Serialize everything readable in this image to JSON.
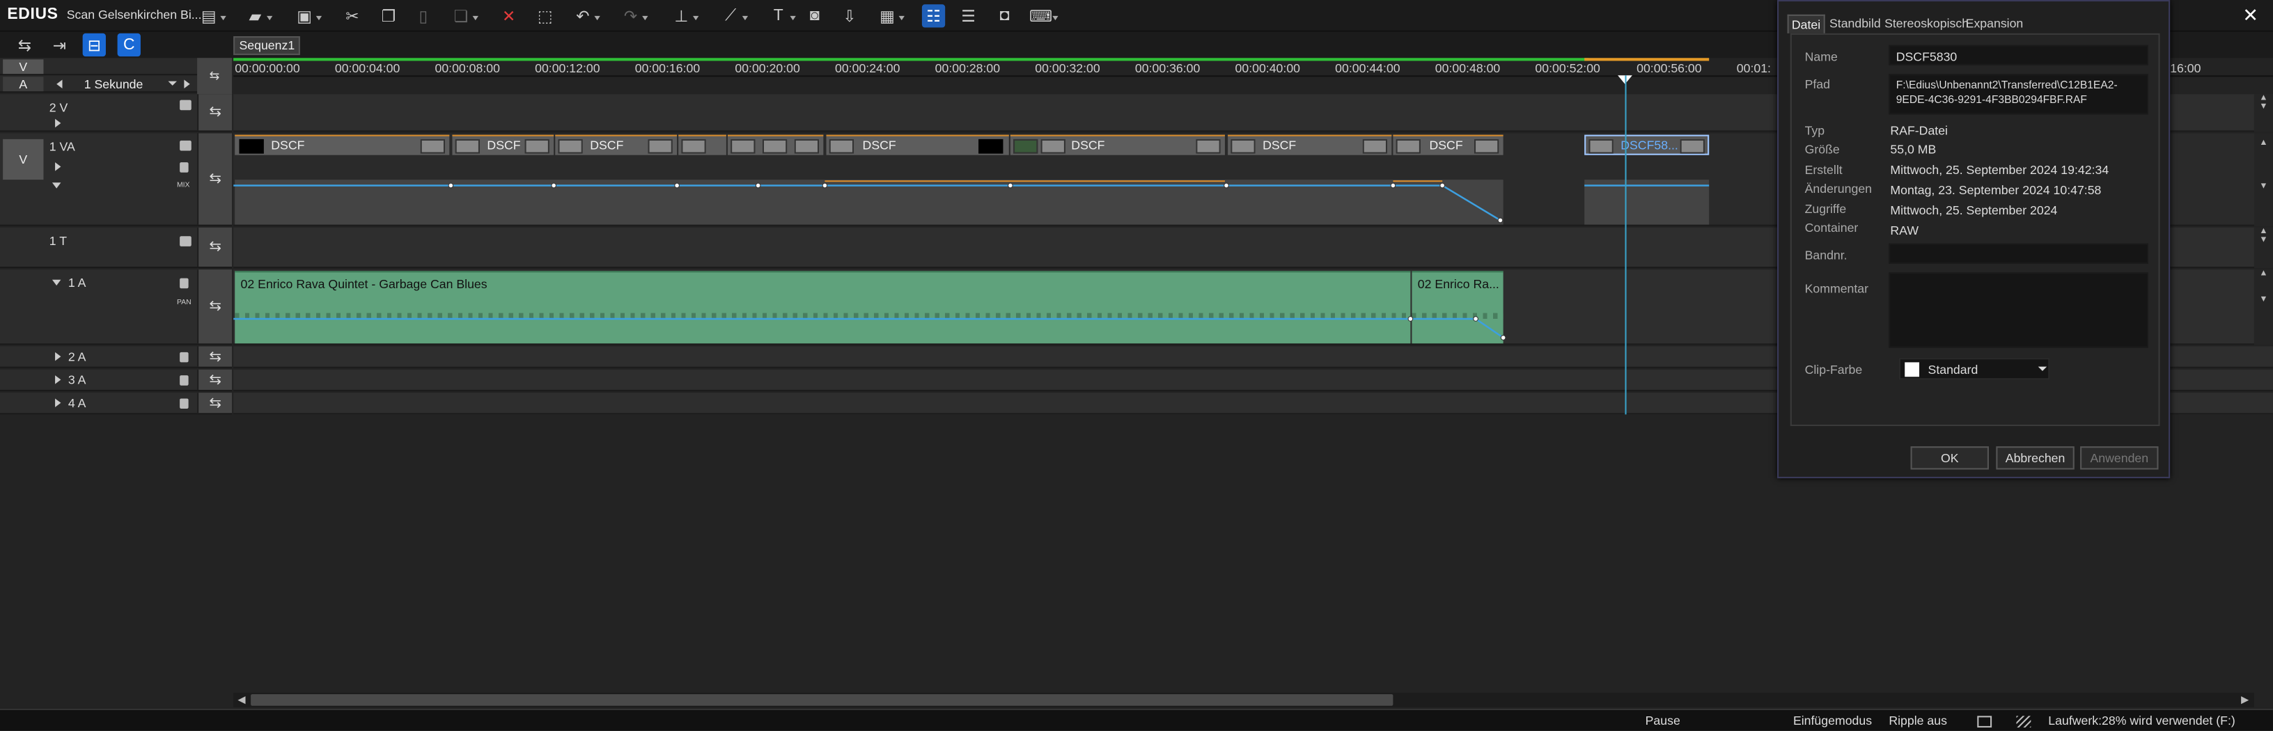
{
  "app": {
    "name": "EDIUS",
    "project": "Scan Gelsenkirchen Bi..."
  },
  "timeline": {
    "sequence_tab": "Sequenz1",
    "scale": "1 Sekunde",
    "track_mode_v": "V",
    "track_mode_a": "A",
    "ruler_ticks": [
      "00:00:00:00",
      "00:00:04:00",
      "00:00:08:00",
      "00:00:12:00",
      "00:00:16:00",
      "00:00:20:00",
      "00:00:24:00",
      "00:00:28:00",
      "00:00:32:00",
      "00:00:36:00",
      "00:00:40:00",
      "00:00:44:00",
      "00:00:48:00",
      "00:00:52:00",
      "00:00:56:00",
      "00:01:",
      "16:00"
    ],
    "tracks": {
      "t2v": "2 V",
      "t1va": "1 VA",
      "t1t": "1 T",
      "t1a": "1 A",
      "t2a": "2 A",
      "t3a": "3 A",
      "t4a": "4 A",
      "va_badge": "V"
    },
    "video_clip_labels": [
      "DSCF",
      "DSCF",
      "DSCF",
      "DSCF",
      "DSCF",
      "DSCF",
      "DSCF",
      "DSCF58..."
    ],
    "audio_clips": [
      "02 Enrico Rava Quintet - Garbage Can Blues",
      "02 Enrico Ra..."
    ],
    "mix_label": "MIX",
    "pan_label": "PAN"
  },
  "dialog": {
    "tabs": [
      "Datei",
      "Standbild",
      "Stereoskopisch",
      "Expansion"
    ],
    "fields": {
      "name_label": "Name",
      "name_value": "DSCF5830",
      "path_label": "Pfad",
      "path_value": "F:\\Edius\\Unbenannt2\\Transferred\\C12B1EA2-9EDE-4C36-9291-4F3BB0294FBF.RAF",
      "type_label": "Typ",
      "type_value": "RAF-Datei",
      "size_label": "Größe",
      "size_value": "55,0 MB",
      "created_label": "Erstellt",
      "created_value": "Mittwoch, 25. September 2024 19:42:34",
      "modified_label": "Änderungen",
      "modified_value": "Montag, 23. September 2024 10:47:58",
      "accessed_label": "Zugriffe",
      "accessed_value": "Mittwoch, 25. September 2024",
      "container_label": "Container",
      "container_value": "RAW",
      "tape_label": "Bandnr.",
      "tape_value": "",
      "comment_label": "Kommentar",
      "comment_value": "",
      "color_label": "Clip-Farbe",
      "color_value": "Standard"
    },
    "buttons": {
      "ok": "OK",
      "cancel": "Abbrechen",
      "apply": "Anwenden"
    }
  },
  "status": {
    "pause": "Pause",
    "insert_mode": "Einfügemodus",
    "ripple": "Ripple aus",
    "drive": "Laufwerk:28% wird verwendet (F:)"
  },
  "colors": {
    "accent": "#1f5fb8",
    "audio_clip": "#5fa27c",
    "clip_border": "#d68a2c",
    "playhead": "#39a3c9",
    "render_bar": "#2fbf36"
  }
}
